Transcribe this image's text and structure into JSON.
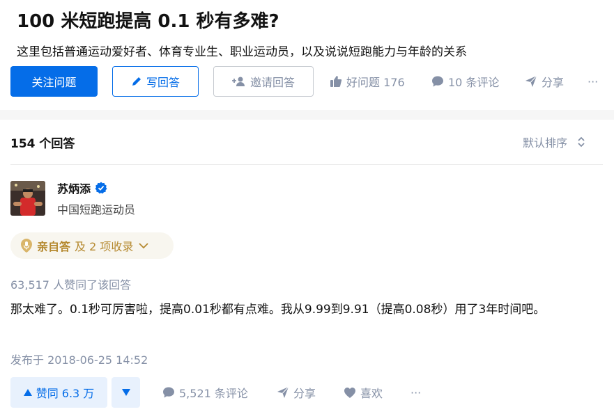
{
  "question": {
    "title": "100 米短跑提高 0.1 秒有多难?",
    "detail": "这里包括普通运动爱好者、体育专业生、职业运动员，以及说说短跑能力与年龄的关系",
    "follow_label": "关注问题",
    "write_label": "写回答",
    "invite_label": "邀请回答",
    "good_question_label": "好问题 176",
    "comments_label": "10 条评论",
    "share_label": "分享",
    "more_label": "···"
  },
  "answers_header": {
    "count_label": "154 个回答",
    "sort_label": "默认排序"
  },
  "answer": {
    "author_name": "苏炳添",
    "author_bio": "中国短跑运动员",
    "tag_strong": "亲自答",
    "tag_rest": "及 2 项收录",
    "votes_line": "63,517 人赞同了该回答",
    "content": "那太难了。0.1秒可厉害啦，提高0.01秒都有点难。我从9.99到9.91（提高0.08秒）用了3年时间吧。",
    "published": "发布于 2018-06-25 14:52",
    "vote_label": "赞同 6.3 万",
    "comments_label": "5,521 条评论",
    "share_label": "分享",
    "like_label": "喜欢",
    "more_label": "···"
  },
  "icons": {
    "pen": "pen-icon",
    "invite": "add-user-icon",
    "thumb": "thumb-up-icon",
    "comment": "comment-icon",
    "share": "paper-plane-icon",
    "verified": "verified-badge-icon",
    "mic": "mic-icon",
    "sort": "sort-updown-icon",
    "heart": "heart-icon"
  },
  "colors": {
    "accent": "#056de8",
    "muted": "#8590a6",
    "tag_text": "#b5892f",
    "tag_bg": "#f8f6ef"
  }
}
